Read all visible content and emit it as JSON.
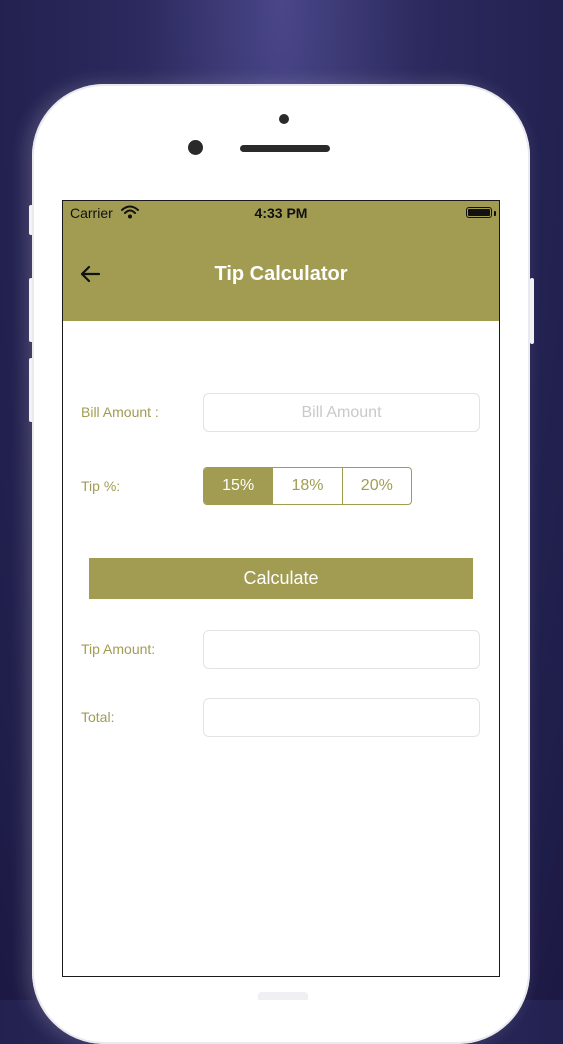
{
  "status_bar": {
    "carrier": "Carrier",
    "time": "4:33 PM"
  },
  "header": {
    "title": "Tip Calculator"
  },
  "form": {
    "bill_label": "Bill Amount :",
    "bill_placeholder": "Bill Amount",
    "bill_value": "",
    "tip_label": "Tip %:",
    "tip_options": [
      "15%",
      "18%",
      "20%"
    ],
    "tip_selected": "15%",
    "calculate_label": "Calculate",
    "tip_amount_label": "Tip Amount:",
    "tip_amount_value": "",
    "total_label": "Total:",
    "total_value": ""
  },
  "colors": {
    "accent": "#a19c52",
    "background_top": "#4a4689",
    "background_bottom": "#1c1a44"
  }
}
